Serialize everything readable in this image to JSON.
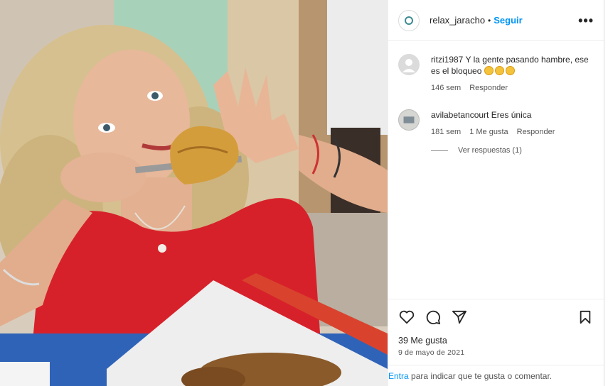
{
  "post": {
    "username": "relax_jaracho",
    "separator": "•",
    "follow_label": "Seguir",
    "more_label": "•••",
    "avatar_icon": "account-logo-icon"
  },
  "comments": [
    {
      "user": "ritzi1987",
      "text": "Y la gente pasando hambre, ese es el bloqueo",
      "emoji_count": 3,
      "time": "146 sem",
      "reply_label": "Responder",
      "avatar_icon": "default-avatar-icon"
    },
    {
      "user": "avilabetancourt",
      "text": "Eres única",
      "time": "181 sem",
      "likes": "1 Me gusta",
      "reply_label": "Responder",
      "avatar_icon": "profile-photo-icon",
      "view_replies": "Ver respuestas (1)"
    }
  ],
  "actions": {
    "like_icon": "heart-icon",
    "comment_icon": "comment-icon",
    "share_icon": "share-icon",
    "save_icon": "bookmark-icon"
  },
  "likes_text": "39 Me gusta",
  "date_text": "9 de mayo de 2021",
  "login": {
    "link_text": "Entra",
    "rest_text": " para indicar que te gusta o comentar."
  },
  "colors": {
    "accent": "#0095f6",
    "text": "#262626",
    "muted": "#8e8e8e",
    "shirt": "#d7212a"
  }
}
